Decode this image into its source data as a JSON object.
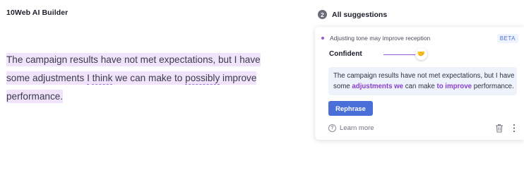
{
  "app": {
    "title": "10Web AI Builder"
  },
  "editor": {
    "text_before_1": "The campaign results have not met expectations, but I have some adjustments ",
    "flagged_word_1": "I",
    "space_1": " ",
    "flagged_word_2": "think",
    "text_middle": " we can make to ",
    "flagged_word_3": "possibly",
    "text_after": " improve performance."
  },
  "panel": {
    "step_number": "2",
    "title": "All suggestions",
    "card": {
      "subtitle": "Adjusting tone may improve reception",
      "badge": "BETA",
      "tone_label": "Confident",
      "tone_emoji": "🤝",
      "suggestion": {
        "part_1": "The campaign results have not met expectations, but I have some ",
        "inserted_1": "adjustments we",
        "part_2": " can make ",
        "inserted_2": "to improve",
        "part_3": " performance."
      },
      "action_button": "Rephrase",
      "learn_more": "Learn more",
      "icons": {
        "help": "help-circle-icon",
        "trash": "trash-icon",
        "more": "more-vertical-icon"
      }
    }
  },
  "colors": {
    "highlight": "#f1e3fb",
    "accent_purple": "#9b59d6",
    "button_blue": "#4b6fd9",
    "beta_blue": "#4b72d4",
    "suggestion_box": "#eef2fb"
  }
}
